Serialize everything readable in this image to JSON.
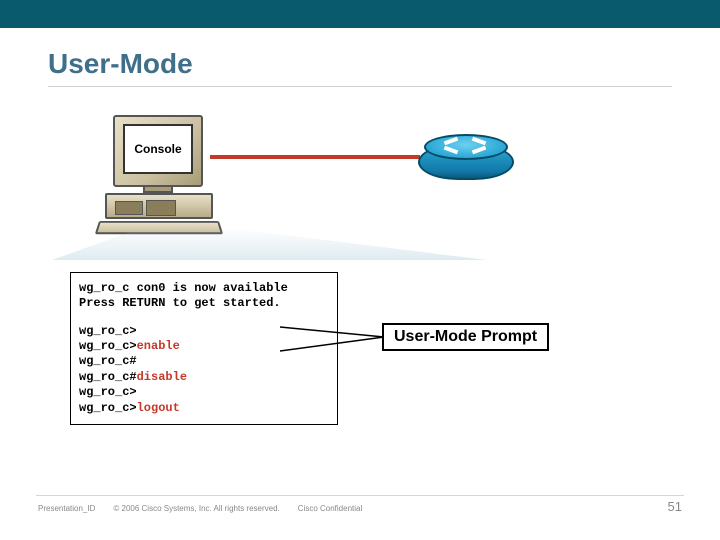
{
  "header": {
    "title": "User-Mode"
  },
  "diagram": {
    "console_label": "Console",
    "computer_icon": "desktop-computer-icon",
    "router_icon": "cisco-router-icon"
  },
  "terminal": {
    "lines": [
      {
        "text": "wg_ro_c con0 is now available"
      },
      {
        "text": "Press RETURN to get started."
      },
      {
        "gap": true
      },
      {
        "prompt": "wg_ro_c>"
      },
      {
        "prompt": "wg_ro_c>",
        "cmd": "enable"
      },
      {
        "prompt": "wg_ro_c#"
      },
      {
        "prompt": "wg_ro_c#",
        "cmd": "disable"
      },
      {
        "prompt": "wg_ro_c>"
      },
      {
        "prompt": "wg_ro_c>",
        "cmd": "logout"
      }
    ]
  },
  "callout": {
    "label": "User-Mode Prompt"
  },
  "footer": {
    "presentation_id": "Presentation_ID",
    "copyright": "© 2006 Cisco Systems, Inc. All rights reserved.",
    "confidential": "Cisco Confidential",
    "page": "51"
  }
}
